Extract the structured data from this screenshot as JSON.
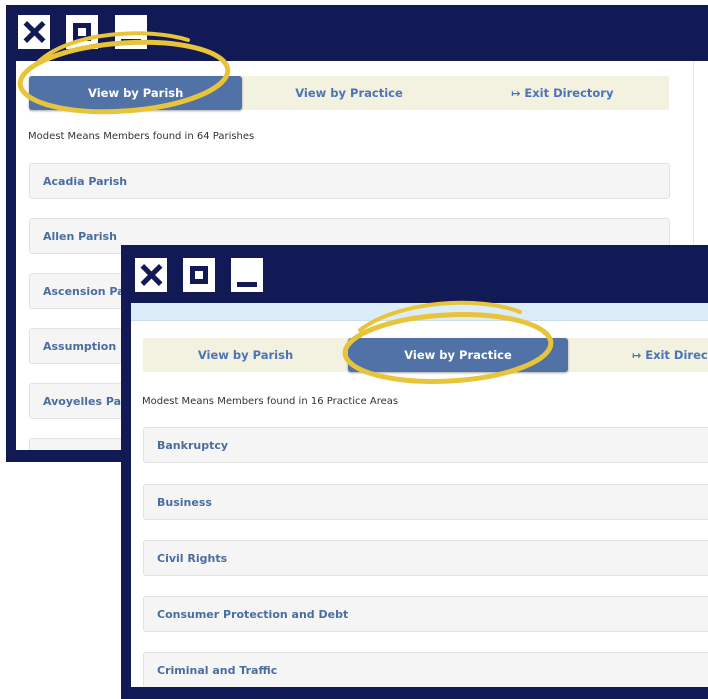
{
  "accent_color": "#121a55",
  "highlight_color": "#e8c43a",
  "window_back": {
    "controls": [
      "close-icon",
      "maximize-icon",
      "minimize-icon"
    ],
    "tabs": [
      {
        "label": "View by Parish",
        "active": true
      },
      {
        "label": "View by Practice",
        "active": false
      },
      {
        "label": "Exit Directory",
        "icon": "exit-icon",
        "active": false
      }
    ],
    "found_text": "Modest Means Members found in 64 Parishes",
    "items": [
      "Acadia Parish",
      "Allen Parish",
      "Ascension Parish",
      "Assumption Parish",
      "Avoyelles Parish"
    ]
  },
  "window_front": {
    "controls": [
      "close-icon",
      "maximize-icon",
      "minimize-icon"
    ],
    "tabs": [
      {
        "label": "View by Parish",
        "active": false
      },
      {
        "label": "View by Practice",
        "active": true
      },
      {
        "label": "Exit Directory",
        "icon": "exit-icon",
        "active": false
      }
    ],
    "found_text": "Modest Means Members found in 16 Practice Areas",
    "items": [
      "Bankruptcy",
      "Business",
      "Civil Rights",
      "Consumer Protection and Debt",
      "Criminal and Traffic"
    ]
  }
}
